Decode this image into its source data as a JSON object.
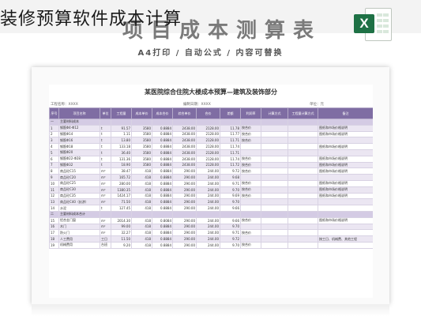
{
  "page_title": "装修预算软件成本计算",
  "banner_title": "项目成本测算表",
  "subtitle": "A4打印 / 自动公式 / 内容可替换",
  "excel_icon": {
    "letter": "X",
    "color": "#1e7145"
  },
  "sheet": {
    "title": "某医院综合住院大楼成本预算—建筑及装饰部分",
    "meta_left": "工程名称：XXXX",
    "meta_mid": "编制日期：XXXX",
    "meta_right": "单位：元",
    "header_color": "#7f6da3",
    "columns": [
      "序号",
      "项目名称",
      "单位",
      "工程量",
      "成本单价",
      "成本合价",
      "综合单价",
      "合价",
      "差额",
      "利润率",
      "计算方式",
      "工程量计算方式",
      "备注"
    ],
    "rows": [
      [
        "一",
        "主要材料成本",
        "",
        "",
        "",
        "",
        "",
        "",
        "",
        "",
        "",
        "",
        ""
      ],
      [
        "1",
        "钢筋Φ4-Φ12",
        "t",
        "91.57",
        "3580",
        "0.8884",
        "2438.00",
        "2128.00",
        "11.78",
        "按合价",
        "",
        "",
        "图纸和市场价格说明"
      ],
      [
        "2",
        "钢筋Φ14",
        "t",
        "1.11",
        "3580",
        "0.8884",
        "2438.00",
        "2128.00",
        "11.77",
        "按合价",
        "",
        "",
        "图纸和市场价格说明"
      ],
      [
        "3",
        "钢筋Φ16",
        "t",
        "13.80",
        "3580",
        "0.8884",
        "2438.00",
        "2128.00",
        "11.71",
        "按合价",
        "",
        "",
        ""
      ],
      [
        "4",
        "钢筋Φ18",
        "t",
        "133.18",
        "3580",
        "0.8884",
        "2438.00",
        "2128.00",
        "11.74",
        "",
        "",
        "",
        "图纸和市场价格说明"
      ],
      [
        "5",
        "钢筋Φ20",
        "t",
        "36.40",
        "3580",
        "0.8884",
        "2438.00",
        "2128.00",
        "11.71",
        "",
        "",
        "",
        ""
      ],
      [
        "6",
        "钢筋Φ22-Φ28",
        "t",
        "131.36",
        "3580",
        "0.8884",
        "2438.00",
        "2128.00",
        "11.74",
        "按合价",
        "",
        "",
        "图纸和市场价格说明"
      ],
      [
        "7",
        "钢筋Φ32",
        "t",
        "18.90",
        "3580",
        "0.8884",
        "2438.00",
        "2128.00",
        "11.72",
        "按合价",
        "",
        "",
        "图纸和市场价格说明"
      ],
      [
        "8",
        "商品砼C15",
        "m³",
        "38.47",
        "418",
        "0.8884",
        "290.00",
        "244.00",
        "9.72",
        "按合价",
        "",
        "",
        "图纸和市场价格说明"
      ],
      [
        "9",
        "商品砼C20",
        "m³",
        "165.72",
        "418",
        "0.8884",
        "290.00",
        "244.00",
        "9.68",
        "",
        "",
        "",
        ""
      ],
      [
        "10",
        "商品砼C25",
        "m³",
        "280.00",
        "418",
        "0.8884",
        "290.00",
        "244.00",
        "9.71",
        "按合价",
        "",
        "",
        "图纸和市场价格说明"
      ],
      [
        "11",
        "商品砼C30",
        "m³",
        "1380.35",
        "418",
        "0.8884",
        "290.00",
        "244.00",
        "9.70",
        "按合价",
        "",
        "",
        "图纸和市场价格说明"
      ],
      [
        "12",
        "商品砼C35",
        "m³",
        "1424.17",
        "418",
        "0.8884",
        "290.00",
        "244.00",
        "9.69",
        "按合价",
        "",
        "",
        "图纸和市场价格说明"
      ],
      [
        "13",
        "商品砼C40（抗渗）",
        "m³",
        "71.50",
        "418",
        "0.8884",
        "290.00",
        "244.00",
        "9.70",
        "",
        "",
        "",
        ""
      ],
      [
        "14",
        "水泥",
        "t",
        "127.45",
        "418",
        "0.8884",
        "290.00",
        "244.00",
        "9.66",
        "",
        "",
        "",
        ""
      ],
      [
        "二",
        "主要材料成本合计",
        "",
        "",
        "",
        "",
        "",
        "",
        "",
        "",
        "",
        "",
        ""
      ],
      [
        "15",
        "铝合金门窗",
        "m²",
        "2014.30",
        "418",
        "0.8084",
        "290.00",
        "244.00",
        "9.66",
        "按合价",
        "",
        "",
        "图纸和市场价格说明"
      ],
      [
        "16",
        "木门",
        "m²",
        "99.00",
        "418",
        "0.8884",
        "290.00",
        "244.00",
        "9.70",
        "",
        "",
        "",
        ""
      ],
      [
        "17",
        "防火门",
        "m²",
        "32.27",
        "418",
        "0.8884",
        "290.00",
        "244.00",
        "9.71",
        "按合价",
        "",
        "",
        ""
      ],
      [
        "18",
        "人工费用",
        "工日",
        "11.50",
        "418",
        "0.8884",
        "290.00",
        "244.00",
        "9.72",
        "",
        "",
        "",
        "按工日、机械费、其他工程"
      ],
      [
        "19",
        "机械费用",
        "台班",
        "9.20",
        "418",
        "0.8884",
        "290.00",
        "244.00",
        "9.70",
        "按合价",
        "",
        "",
        ""
      ]
    ]
  }
}
